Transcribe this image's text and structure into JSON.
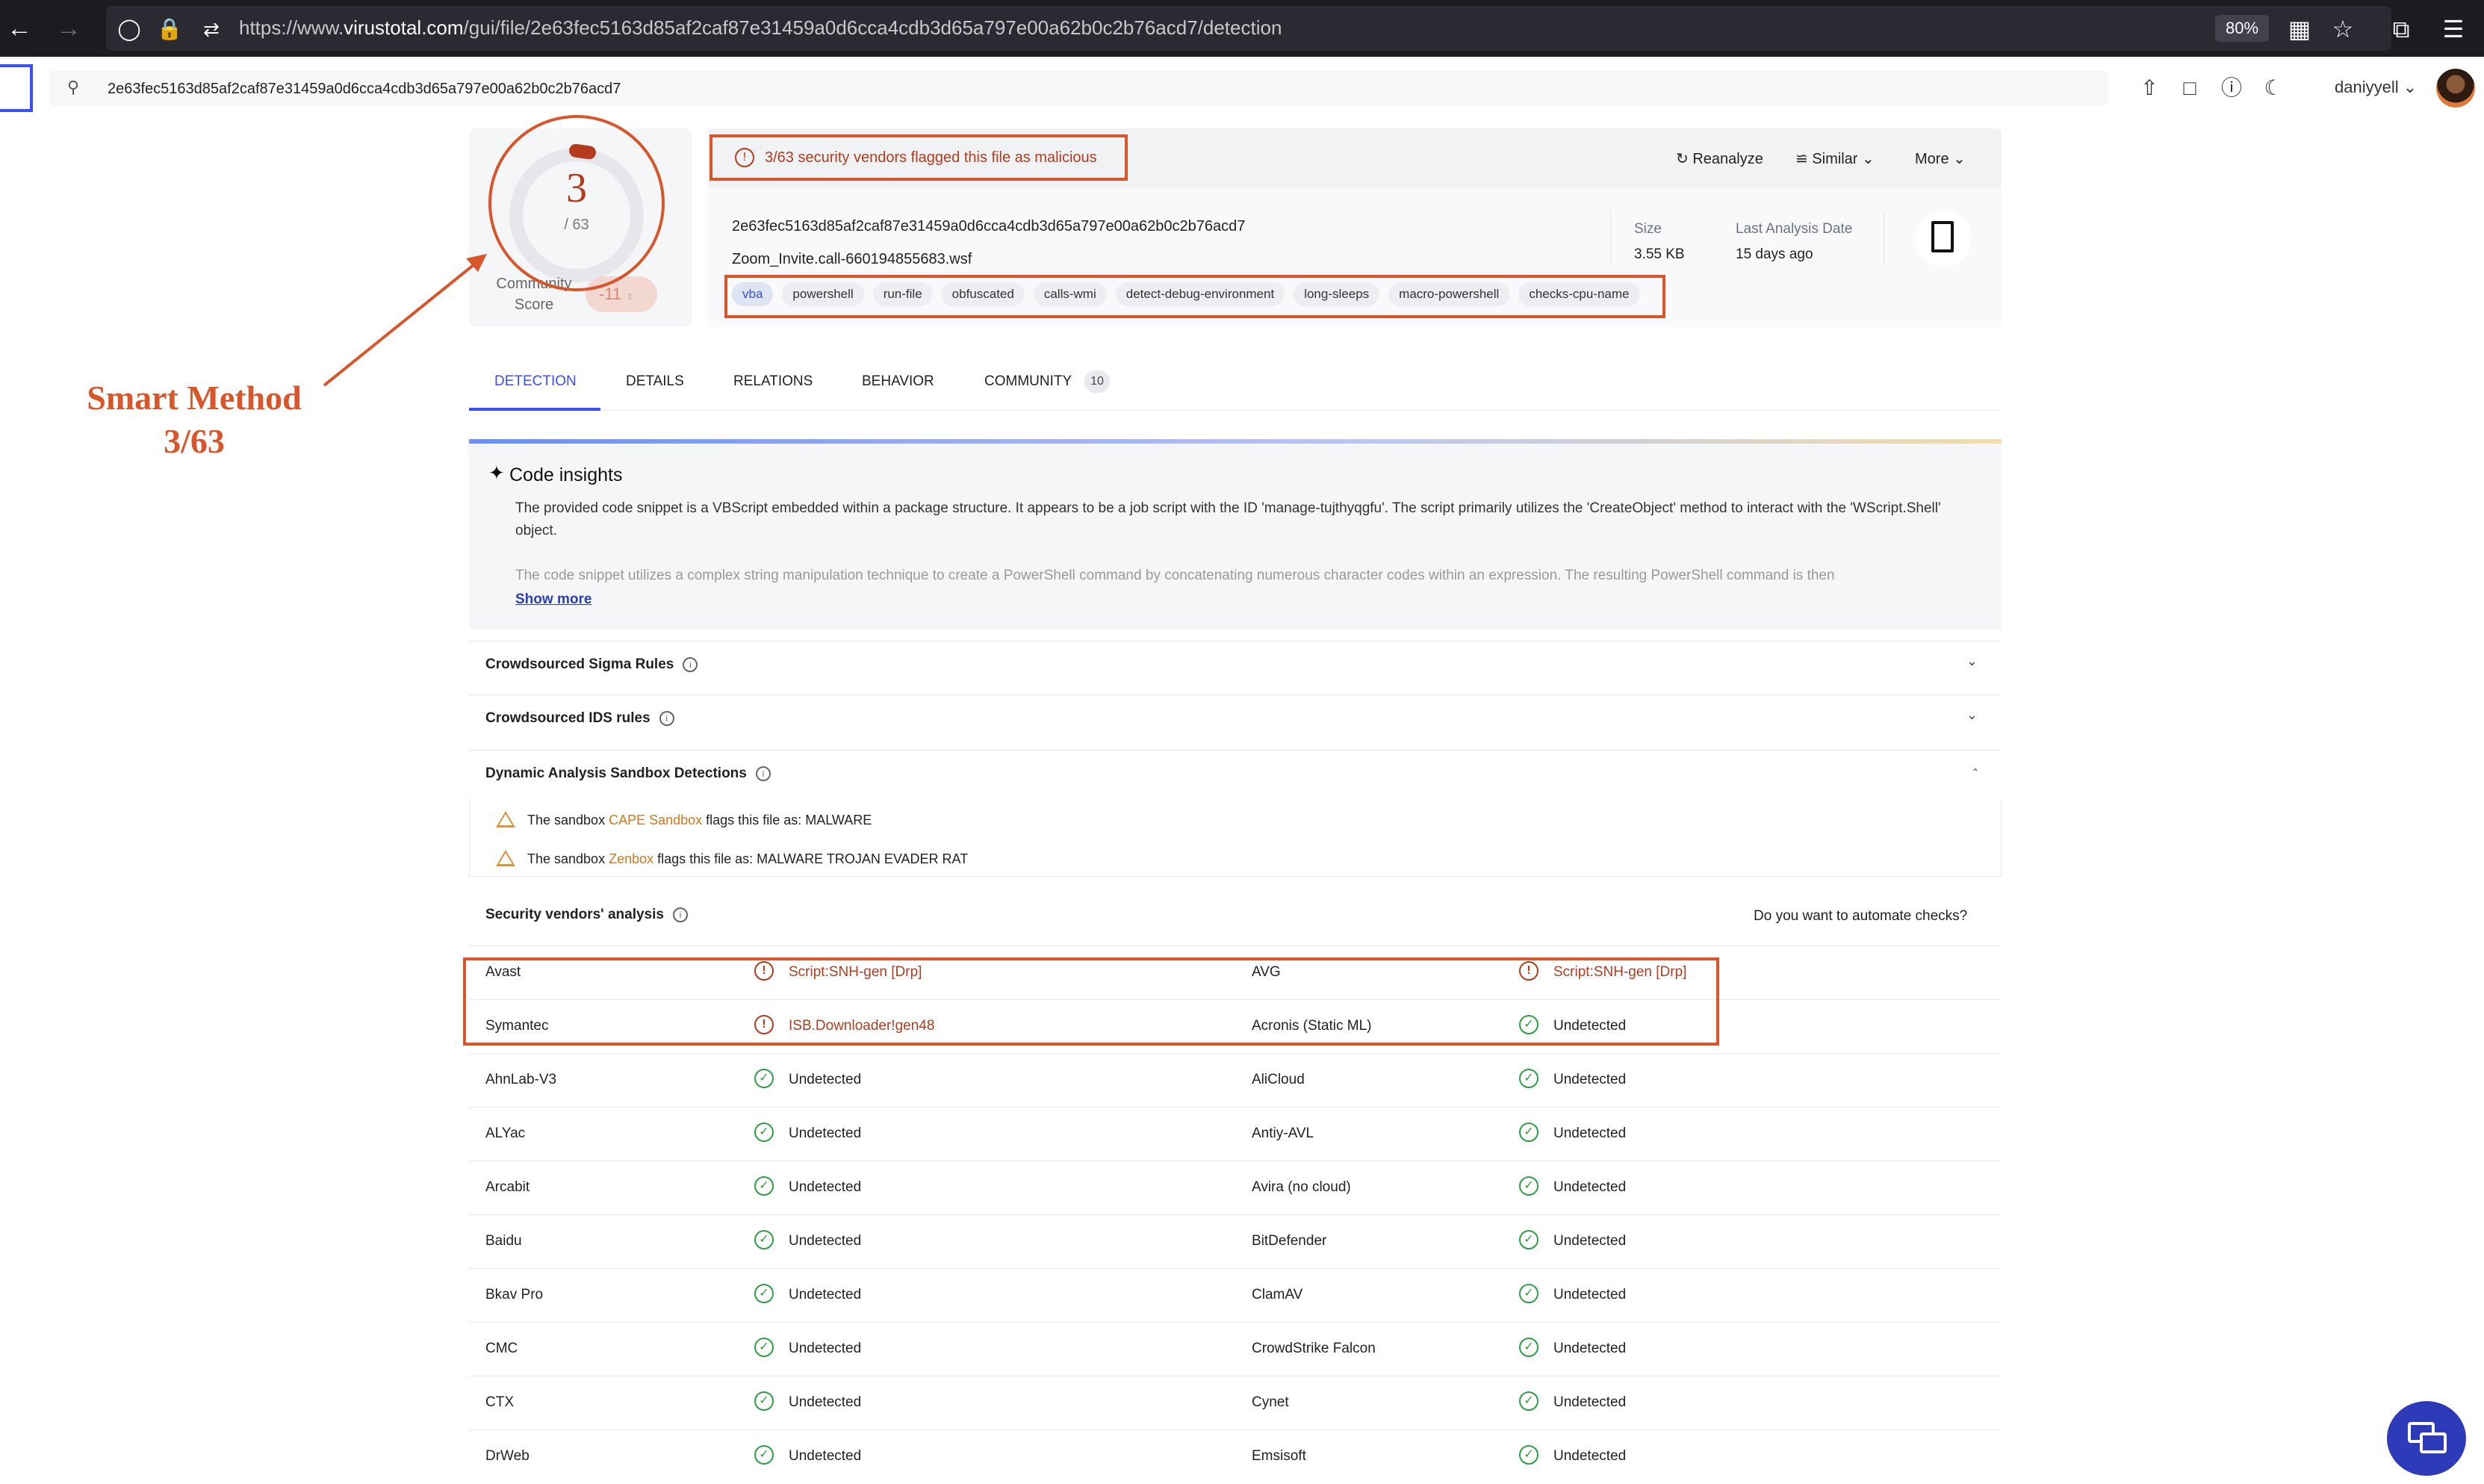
{
  "browser": {
    "url_prefix": "https://www.",
    "url_domain": "virustotal.com",
    "url_path": "/gui/file/2e63fec5163d85af2caf87e31459a0d6cca4cdb3d65a797e00a62b0c2b76acd7/detection",
    "zoom": "80%"
  },
  "header": {
    "search_value": "2e63fec5163d85af2caf87e31459a0d6cca4cdb3d65a797e00a62b0c2b76acd7",
    "user": "daniyyell"
  },
  "score": {
    "detections": "3",
    "total": "/ 63",
    "community_label_1": "Community",
    "community_label_2": "Score",
    "community_value": "-11"
  },
  "file": {
    "flag_text": "3/63 security vendors flagged this file as malicious",
    "actions": {
      "reanalyze": "Reanalyze",
      "similar": "Similar",
      "more": "More"
    },
    "hash": "2e63fec5163d85af2caf87e31459a0d6cca4cdb3d65a797e00a62b0c2b76acd7",
    "name": "Zoom_Invite.call-660194855683.wsf",
    "tags": [
      "vba",
      "powershell",
      "run-file",
      "obfuscated",
      "calls-wmi",
      "detect-debug-environment",
      "long-sleeps",
      "macro-powershell",
      "checks-cpu-name"
    ],
    "size_label": "Size",
    "size_value": "3.55 KB",
    "date_label": "Last Analysis Date",
    "date_value": "15 days ago"
  },
  "annotation": {
    "line1": "Smart Method",
    "line2": "3/63"
  },
  "tabs": {
    "detection": "DETECTION",
    "details": "DETAILS",
    "relations": "RELATIONS",
    "behavior": "BEHAVIOR",
    "community": "COMMUNITY",
    "community_count": "10"
  },
  "insights": {
    "title": "Code insights",
    "p1": "The provided code snippet is a VBScript embedded within a package structure. It appears to be a job script with the ID 'manage-tujthyqgfu'. The script primarily utilizes the 'CreateObject' method to interact with the 'WScript.Shell' object.",
    "p2": "The code snippet utilizes a complex string manipulation technique to create a PowerShell command by concatenating numerous character codes within an expression. The resulting PowerShell command is then",
    "show_more": "Show more"
  },
  "sections": {
    "sigma": "Crowdsourced Sigma Rules",
    "ids": "Crowdsourced IDS rules",
    "sandbox": "Dynamic Analysis Sandbox Detections",
    "vendors": "Security vendors' analysis",
    "automate": "Do you want to automate checks?"
  },
  "sandbox": [
    {
      "prefix": "The sandbox ",
      "name": "CAPE Sandbox",
      "suffix": " flags this file as: MALWARE"
    },
    {
      "prefix": "The sandbox ",
      "name": "Zenbox",
      "suffix": " flags this file as: MALWARE TROJAN EVADER RAT"
    }
  ],
  "vendors": [
    {
      "left": "Avast",
      "left_result": "Script:SNH-gen [Drp]",
      "left_status": "bad",
      "right": "AVG",
      "right_result": "Script:SNH-gen [Drp]",
      "right_status": "bad"
    },
    {
      "left": "Symantec",
      "left_result": "ISB.Downloader!gen48",
      "left_status": "bad",
      "right": "Acronis (Static ML)",
      "right_result": "Undetected",
      "right_status": "ok"
    },
    {
      "left": "AhnLab-V3",
      "left_result": "Undetected",
      "left_status": "ok",
      "right": "AliCloud",
      "right_result": "Undetected",
      "right_status": "ok"
    },
    {
      "left": "ALYac",
      "left_result": "Undetected",
      "left_status": "ok",
      "right": "Antiy-AVL",
      "right_result": "Undetected",
      "right_status": "ok"
    },
    {
      "left": "Arcabit",
      "left_result": "Undetected",
      "left_status": "ok",
      "right": "Avira (no cloud)",
      "right_result": "Undetected",
      "right_status": "ok"
    },
    {
      "left": "Baidu",
      "left_result": "Undetected",
      "left_status": "ok",
      "right": "BitDefender",
      "right_result": "Undetected",
      "right_status": "ok"
    },
    {
      "left": "Bkav Pro",
      "left_result": "Undetected",
      "left_status": "ok",
      "right": "ClamAV",
      "right_result": "Undetected",
      "right_status": "ok"
    },
    {
      "left": "CMC",
      "left_result": "Undetected",
      "left_status": "ok",
      "right": "CrowdStrike Falcon",
      "right_result": "Undetected",
      "right_status": "ok"
    },
    {
      "left": "CTX",
      "left_result": "Undetected",
      "left_status": "ok",
      "right": "Cynet",
      "right_result": "Undetected",
      "right_status": "ok"
    },
    {
      "left": "DrWeb",
      "left_result": "Undetected",
      "left_status": "ok",
      "right": "Emsisoft",
      "right_result": "Undetected",
      "right_status": "ok"
    }
  ],
  "colors": {
    "accent": "#394eff",
    "malicious": "#b53b1f",
    "annotation": "#d9552a",
    "clean": "#2f9e44"
  }
}
